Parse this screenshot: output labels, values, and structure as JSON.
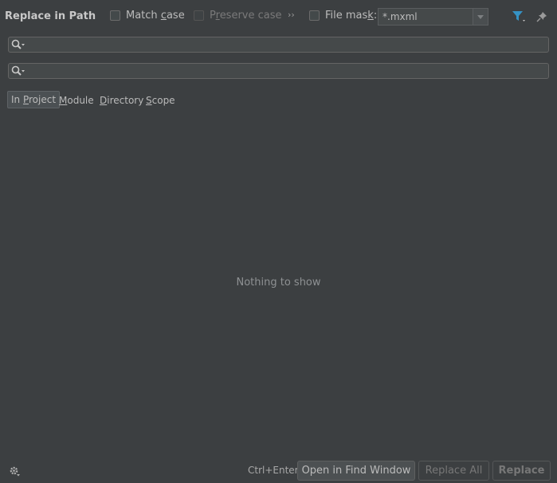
{
  "dialog": {
    "title": "Replace in Path"
  },
  "options": {
    "match_case": {
      "label_pre": "Match ",
      "label_mn": "c",
      "label_post": "ase",
      "checked": false
    },
    "preserve_case": {
      "label_pre": "P",
      "label_mn": "r",
      "label_post": "eserve case",
      "checked": false,
      "disabled": true
    },
    "more_glyph": "››",
    "file_mask": {
      "label_pre": "File mas",
      "label_mn": "k",
      "label_post": ":",
      "checked": false,
      "value": "*.mxml"
    }
  },
  "icons": {
    "filter": "filter-icon",
    "pin": "pin-icon",
    "search": "search-icon",
    "settings": "gear-icon"
  },
  "search_field": {
    "value": ""
  },
  "replace_field": {
    "value": ""
  },
  "scopes": [
    {
      "pre": "In ",
      "mn": "P",
      "post": "roject",
      "active": true
    },
    {
      "pre": "",
      "mn": "M",
      "post": "odule",
      "active": false
    },
    {
      "pre": "",
      "mn": "D",
      "post": "irectory",
      "active": false
    },
    {
      "pre": "",
      "mn": "S",
      "post": "cope",
      "active": false
    }
  ],
  "results": {
    "empty_text": "Nothing to show"
  },
  "footer": {
    "shortcut_hint": "Ctrl+Enter",
    "open_in_find_window": "Open in Find Window",
    "replace_all": "Replace All",
    "replace": "Replace"
  },
  "colors": {
    "background": "#3c3f41",
    "accent_blue": "#3592c4"
  }
}
